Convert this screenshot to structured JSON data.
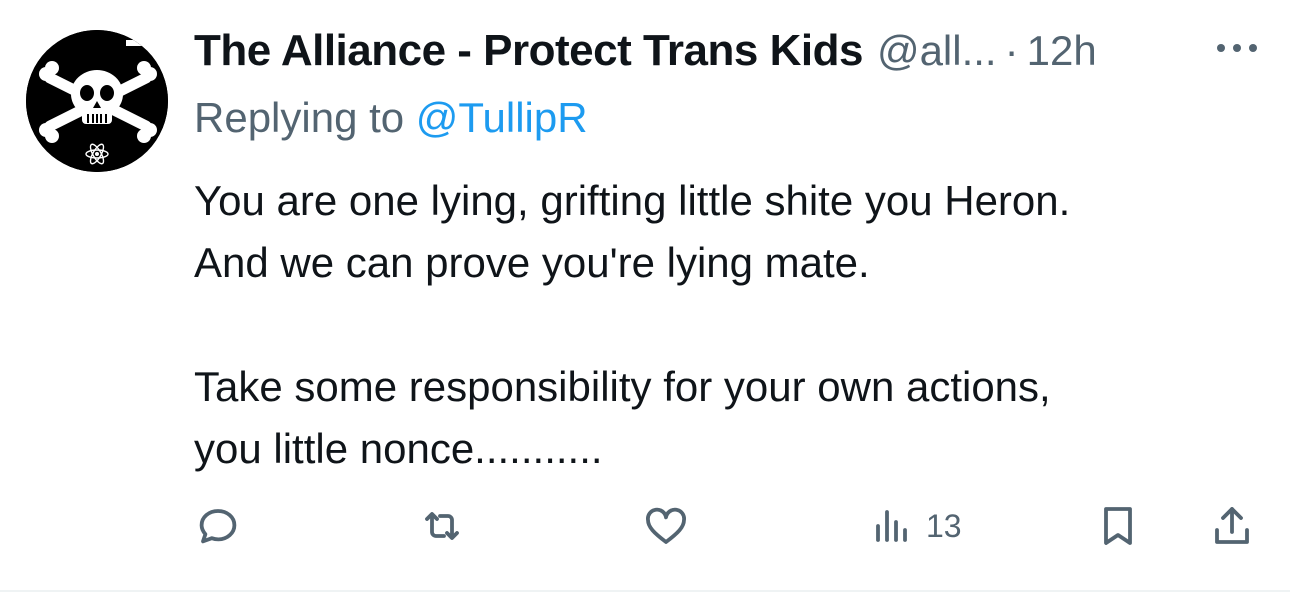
{
  "tweet": {
    "author": {
      "display_name": "The Alliance - Protect Trans Kids",
      "handle": "@all...",
      "separator": "·",
      "time": "12h"
    },
    "reply": {
      "prefix": "Replying to ",
      "mention": "@TullipR"
    },
    "body": {
      "line1": "You are one lying, grifting little shite you Heron.",
      "line2": "And we can prove you're lying mate.",
      "line3": "Take some responsibility for your own actions,",
      "line4": "you little nonce..........."
    },
    "stats": {
      "views": "13"
    }
  },
  "icons": {
    "avatar": "skull-crossbones-avatar",
    "more": "more-icon",
    "reply": "reply-icon",
    "retweet": "retweet-icon",
    "like": "heart-icon",
    "views": "views-icon",
    "bookmark": "bookmark-icon",
    "share": "share-icon"
  },
  "colors": {
    "text": "#0f1419",
    "secondary": "#536471",
    "link": "#1d9bf0",
    "divider": "#eff3f4"
  }
}
